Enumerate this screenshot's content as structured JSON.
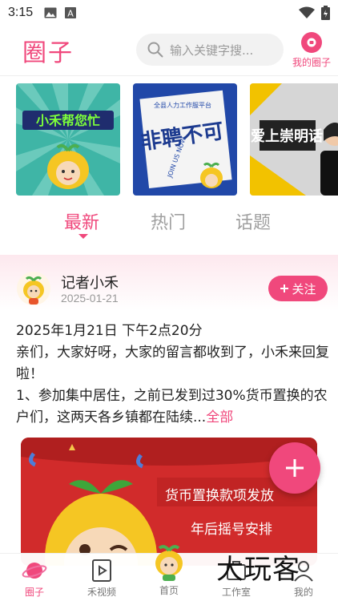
{
  "status_bar": {
    "time": "3:15"
  },
  "header": {
    "title": "圈子",
    "search_placeholder": "输入关键字搜...",
    "my_circle_label": "我的圈子"
  },
  "banners": [
    {
      "title": "小禾帮您忙",
      "bg": "#3fb5a6"
    },
    {
      "title": "非聘不可",
      "subtitle": "全县人力工作服平台",
      "bg": "#2148a8"
    },
    {
      "title": "爱上崇明话",
      "bg": "#d9d9d9"
    }
  ],
  "tabs": [
    {
      "label": "最新",
      "active": true
    },
    {
      "label": "热门",
      "active": false
    },
    {
      "label": "话题",
      "active": false
    }
  ],
  "post": {
    "author": "记者小禾",
    "date": "2025-01-21",
    "follow_label": "关注",
    "text_line1": "2025年1月21日 下午2点20分",
    "text_body": "亲们，大家好呀，大家的留言都收到了，小禾来回复啦！",
    "text_body2": "1、参加集中居住，之前已发到过30%货币置换的农户们，这两天各乡镇都在陆续...",
    "more_label": "全部",
    "image_caption1": "货币置换款项发放",
    "image_caption2": "年后摇号安排"
  },
  "bottom_nav": [
    {
      "label": "圈子",
      "icon": "planet-icon",
      "active": true
    },
    {
      "label": "禾视频",
      "icon": "video-icon",
      "active": false
    },
    {
      "label": "首页",
      "icon": "home-mascot-icon",
      "active": false
    },
    {
      "label": "工作室",
      "icon": "studio-icon",
      "active": false
    },
    {
      "label": "我的",
      "icon": "profile-icon",
      "active": false
    }
  ],
  "watermark": "大玩客",
  "colors": {
    "accent": "#f0487c",
    "text": "#222222",
    "muted": "#999999"
  }
}
